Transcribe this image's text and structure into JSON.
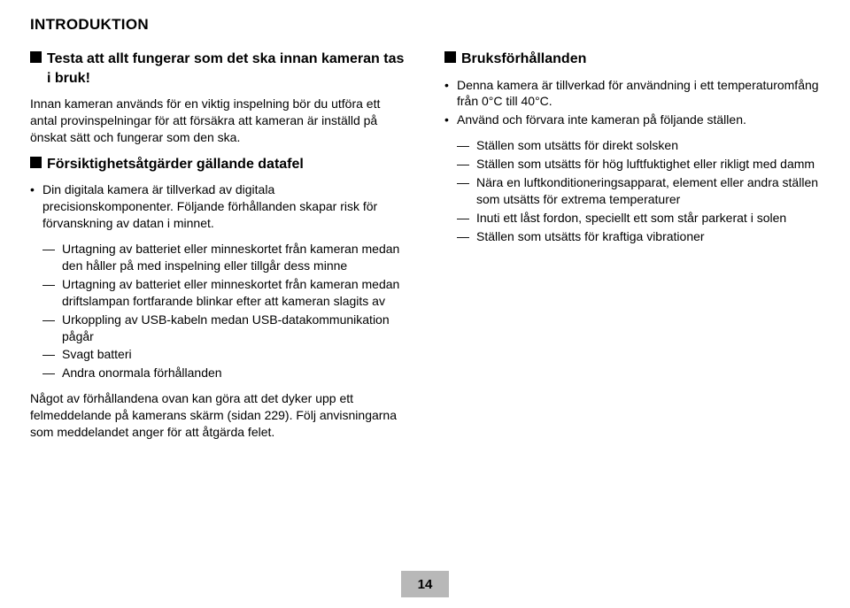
{
  "header": "INTRODUKTION",
  "pageNumber": "14",
  "left": {
    "section1": {
      "title": "Testa att allt fungerar som det ska innan kameran tas i bruk!",
      "para": "Innan kameran används för en viktig inspelning bör du utföra ett antal provinspelningar för att försäkra att kameran är inställd på önskat sätt och fungerar som den ska."
    },
    "section2": {
      "title": "Försiktighetsåtgärder gällande datafel",
      "bullet": "Din digitala kamera är tillverkad av digitala precisionskomponenter. Följande förhållanden skapar risk för förvanskning av datan i minnet.",
      "dashes": [
        "Urtagning av batteriet eller minneskortet från kameran medan den håller på med inspelning eller tillgår dess minne",
        "Urtagning av batteriet eller minneskortet från kameran medan driftslampan fortfarande blinkar efter att kameran slagits av",
        "Urkoppling av USB-kabeln medan USB-datakommunikation pågår",
        "Svagt batteri",
        "Andra onormala förhållanden"
      ],
      "closing": "Något av förhållandena ovan kan göra att det dyker upp ett felmeddelande på kamerans skärm (sidan 229). Följ anvisningarna som meddelandet anger för att åtgärda felet."
    }
  },
  "right": {
    "section1": {
      "title": "Bruksförhållanden",
      "bullets": [
        "Denna kamera är tillverkad för användning i ett temperaturomfång från 0°C till 40°C.",
        "Använd och förvara inte kameran på följande ställen."
      ],
      "dashes": [
        "Ställen som utsätts för direkt solsken",
        "Ställen som utsätts för hög luftfuktighet eller rikligt med damm",
        "Nära en luftkonditioneringsapparat, element eller andra ställen som utsätts för extrema temperaturer",
        "Inuti ett låst fordon, speciellt ett som står parkerat i solen",
        "Ställen som utsätts för kraftiga vibrationer"
      ]
    }
  }
}
